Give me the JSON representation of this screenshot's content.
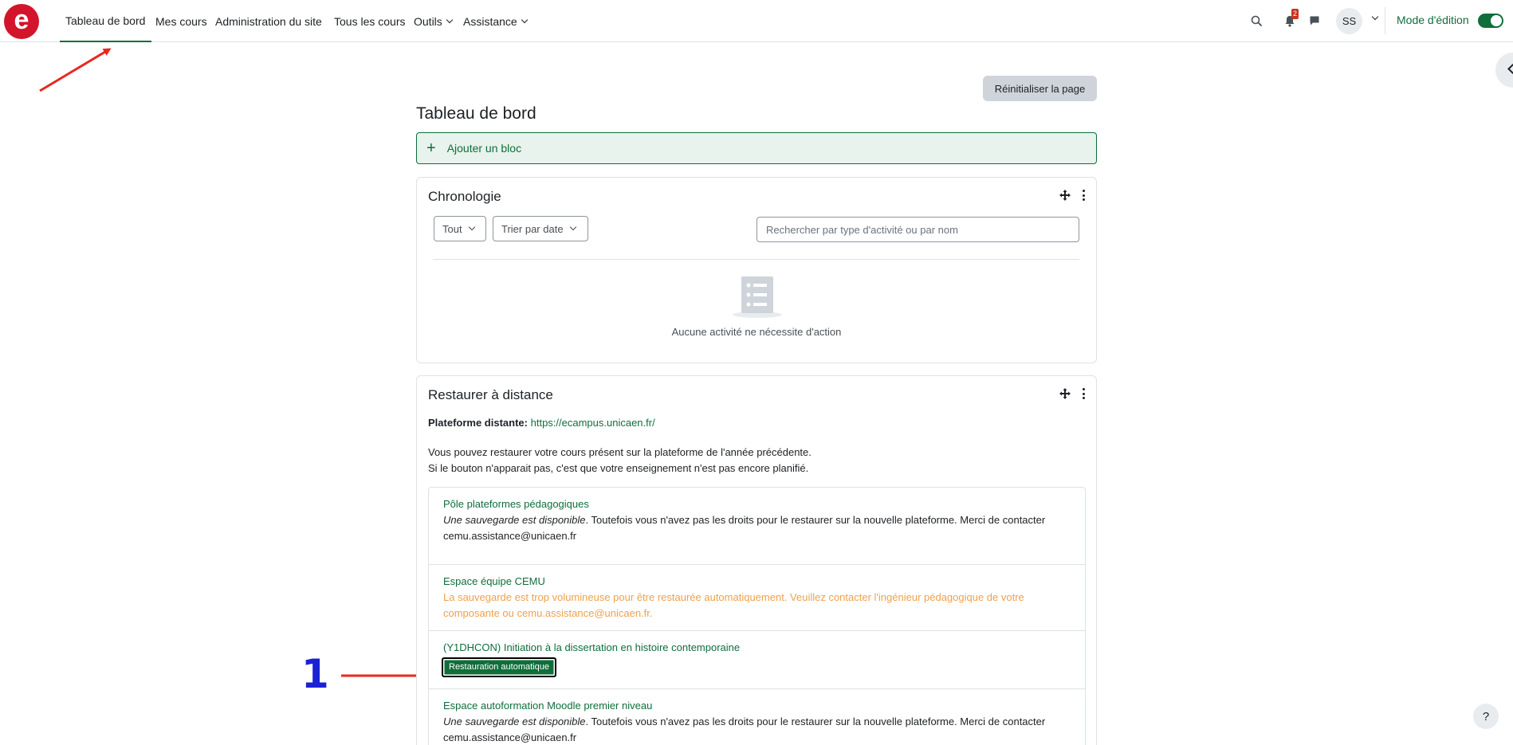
{
  "brand": {
    "logo_letter": "e",
    "color": "#d2152b"
  },
  "nav": {
    "items": [
      {
        "label": "Tableau de bord",
        "active": true
      },
      {
        "label": "Mes cours"
      },
      {
        "label": "Administration du site"
      },
      {
        "label": "Tous les cours"
      },
      {
        "label": "Outils",
        "dropdown": true
      },
      {
        "label": "Assistance",
        "dropdown": true
      }
    ],
    "notification_count": "2",
    "user_initials": "SS",
    "edit_mode_label": "Mode d'édition",
    "edit_mode_on": true,
    "icons": [
      "search-icon",
      "bell-icon",
      "chat-icon",
      "chevron-down-icon"
    ]
  },
  "page": {
    "reset_button": "Réinitialiser la page",
    "title": "Tableau de bord",
    "add_block": {
      "icon": "+",
      "label": "Ajouter un bloc"
    }
  },
  "timeline": {
    "title": "Chronologie",
    "filter_select": "Tout",
    "sort_select": "Trier par date",
    "search_placeholder": "Rechercher par type d'activité ou par nom",
    "empty_message": "Aucune activité ne nécessite d'action"
  },
  "remote_restore": {
    "title": "Restaurer à distance",
    "platform_label": "Plateforme distante:",
    "platform_url": "https://ecampus.unicaen.fr/",
    "intro_line1": "Vous pouvez restaurer votre cours présent sur la plateforme de l'année précédente.",
    "intro_line2": "Si le bouton n'apparait pas, c'est que votre enseignement n'est pas encore planifié.",
    "courses": [
      {
        "name": "Pôle plateformes pédagogiques",
        "status_em": "Une sauvegarde est disponible",
        "status_rest": ". Toutefois vous n'avez pas les droits pour le restaurer sur la nouvelle plateforme. Merci de contacter cemu.assistance@unicaen.fr"
      },
      {
        "name": "Espace équipe CEMU",
        "warning": "La sauvegarde est trop volumineuse pour être restaurée automatiquement. Veuillez contacter l'ingénieur pédagogique de votre composante ou cemu.assistance@unicaen.fr."
      },
      {
        "name": "(Y1DHCON) Initiation à la dissertation en histoire contemporaine",
        "button": "Restauration automatique"
      },
      {
        "name": "Espace autoformation Moodle premier niveau",
        "status_em": "Une sauvegarde est disponible",
        "status_rest": ". Toutefois vous n'avez pas les droits pour le restaurer sur la nouvelle plateforme. Merci de contacter cemu.assistance@unicaen.fr"
      }
    ]
  },
  "annotations": {
    "step_number": "1",
    "arrow_color": "#e8281e",
    "number_color": "#1a22d4"
  },
  "help": {
    "label": "?"
  }
}
